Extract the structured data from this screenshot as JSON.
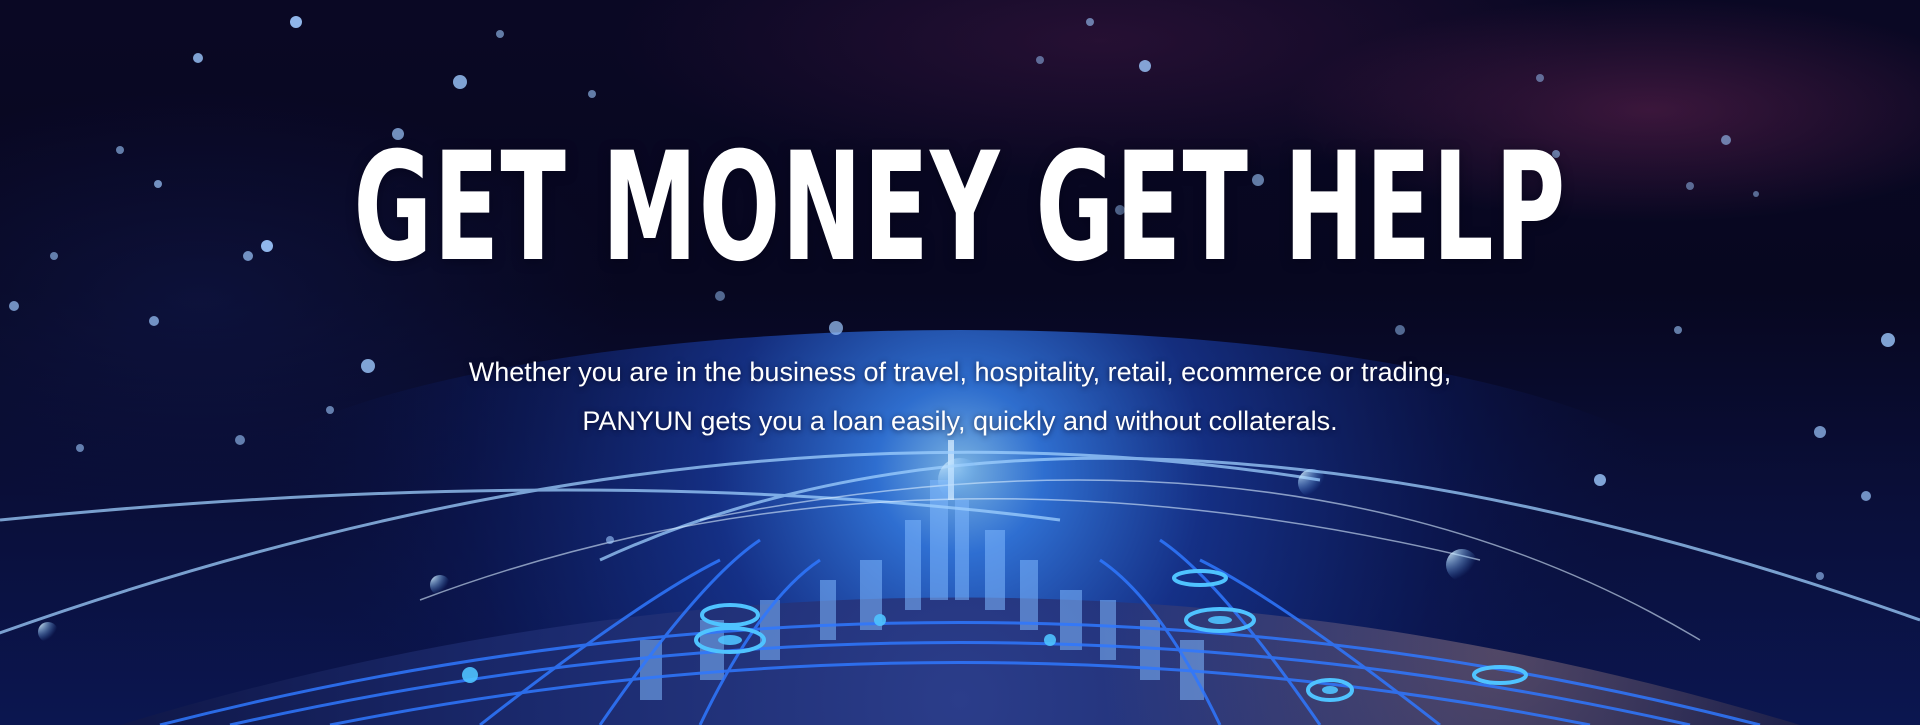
{
  "hero": {
    "headline": "GET MONEY GET HELP",
    "subline_1": "Whether you are in the business of travel, hospitality, retail, ecommerce or trading,",
    "subline_2": "PANYUN gets you a loan easily, quickly and without collaterals."
  },
  "background": {
    "description_icon": "globe-network-illustration",
    "colors": {
      "sky_top": "#0a0824",
      "sky_bottom": "#0b1650",
      "glow": "#6fb8ff",
      "network_line": "#2f78ff",
      "node": "#3fb6ff"
    }
  }
}
